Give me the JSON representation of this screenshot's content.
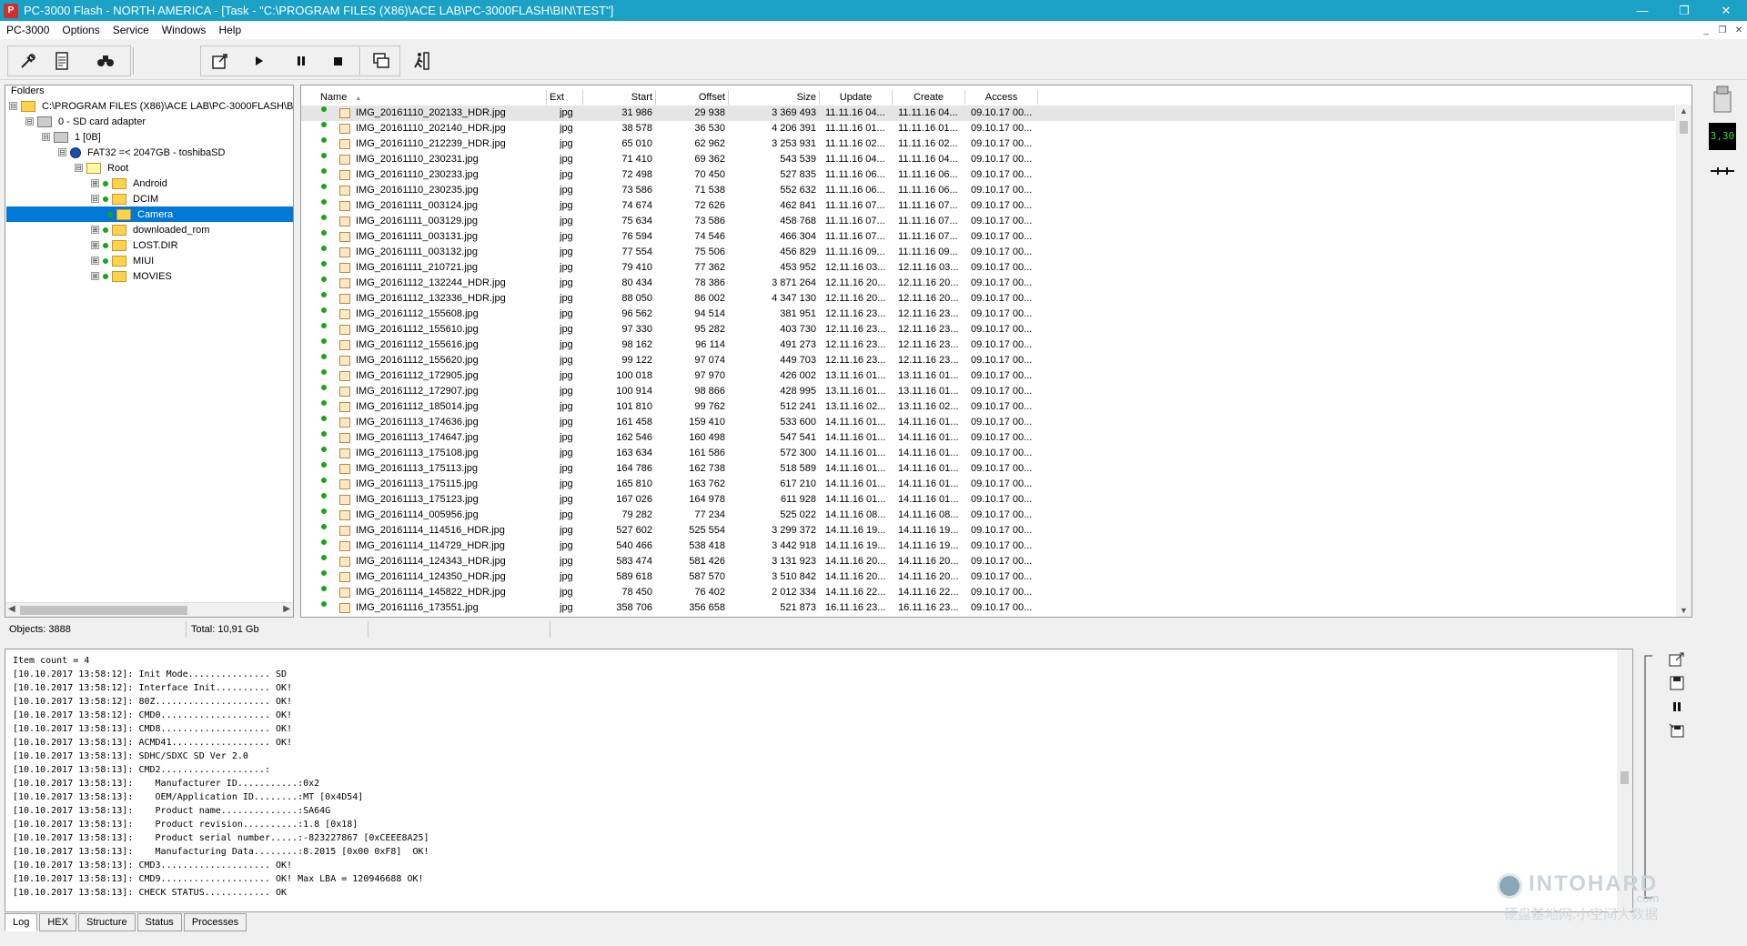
{
  "titlebar": {
    "app_icon": "pc3000-icon",
    "title": "PC-3000 Flash - NORTH AMERICA - [Task - \"C:\\PROGRAM FILES (X86)\\ACE LAB\\PC-3000FLASH\\BIN\\TEST\"]",
    "min": "—",
    "max": "❐",
    "close": "✕"
  },
  "menubar": {
    "items": [
      "PC-3000",
      "Options",
      "Service",
      "Windows",
      "Help"
    ],
    "mdi": [
      "_",
      "❐",
      "✕"
    ]
  },
  "folders": {
    "header": "Folders",
    "tree": [
      {
        "label": "C:\\PROGRAM FILES (X86)\\ACE LAB\\PC-3000FLASH\\B",
        "expander": "⊟"
      },
      {
        "label": "0 - SD card adapter",
        "expander": "⊟"
      },
      {
        "label": "1 [0B]",
        "expander": "⊟"
      },
      {
        "label": "FAT32 =< 2047GB - toshibaSD",
        "expander": "⊟"
      },
      {
        "label": "Root",
        "expander": "⊟"
      },
      {
        "label": "Android",
        "expander": "⊞"
      },
      {
        "label": "DCIM",
        "expander": "⊟"
      },
      {
        "label": "Camera",
        "expander": ""
      },
      {
        "label": "downloaded_rom",
        "expander": "⊞"
      },
      {
        "label": "LOST.DIR",
        "expander": "⊞"
      },
      {
        "label": "MIUI",
        "expander": "⊞"
      },
      {
        "label": "MOVIES",
        "expander": "⊞"
      }
    ]
  },
  "filelist": {
    "columns": [
      "Name",
      "Ext",
      "Start",
      "Offset",
      "Size",
      "Update",
      "Create",
      "Access"
    ],
    "sort_indicator": "▲",
    "rows": [
      [
        "IMG_20161110_202133_HDR.jpg",
        "jpg",
        "31 986",
        "29 938",
        "3 369 493",
        "11.11.16 04...",
        "11.11.16 04...",
        "09.10.17 00..."
      ],
      [
        "IMG_20161110_202140_HDR.jpg",
        "jpg",
        "38 578",
        "36 530",
        "4 206 391",
        "11.11.16 01...",
        "11.11.16 01...",
        "09.10.17 00..."
      ],
      [
        "IMG_20161110_212239_HDR.jpg",
        "jpg",
        "65 010",
        "62 962",
        "3 253 931",
        "11.11.16 02...",
        "11.11.16 02...",
        "09.10.17 00..."
      ],
      [
        "IMG_20161110_230231.jpg",
        "jpg",
        "71 410",
        "69 362",
        "543 539",
        "11.11.16 04...",
        "11.11.16 04...",
        "09.10.17 00..."
      ],
      [
        "IMG_20161110_230233.jpg",
        "jpg",
        "72 498",
        "70 450",
        "527 835",
        "11.11.16 06...",
        "11.11.16 06...",
        "09.10.17 00..."
      ],
      [
        "IMG_20161110_230235.jpg",
        "jpg",
        "73 586",
        "71 538",
        "552 632",
        "11.11.16 06...",
        "11.11.16 06...",
        "09.10.17 00..."
      ],
      [
        "IMG_20161111_003124.jpg",
        "jpg",
        "74 674",
        "72 626",
        "462 841",
        "11.11.16 07...",
        "11.11.16 07...",
        "09.10.17 00..."
      ],
      [
        "IMG_20161111_003129.jpg",
        "jpg",
        "75 634",
        "73 586",
        "458 768",
        "11.11.16 07...",
        "11.11.16 07...",
        "09.10.17 00..."
      ],
      [
        "IMG_20161111_003131.jpg",
        "jpg",
        "76 594",
        "74 546",
        "466 304",
        "11.11.16 07...",
        "11.11.16 07...",
        "09.10.17 00..."
      ],
      [
        "IMG_20161111_003132.jpg",
        "jpg",
        "77 554",
        "75 506",
        "456 829",
        "11.11.16 09...",
        "11.11.16 09...",
        "09.10.17 00..."
      ],
      [
        "IMG_20161111_210721.jpg",
        "jpg",
        "79 410",
        "77 362",
        "453 952",
        "12.11.16 03...",
        "12.11.16 03...",
        "09.10.17 00..."
      ],
      [
        "IMG_20161112_132244_HDR.jpg",
        "jpg",
        "80 434",
        "78 386",
        "3 871 264",
        "12.11.16 20...",
        "12.11.16 20...",
        "09.10.17 00..."
      ],
      [
        "IMG_20161112_132336_HDR.jpg",
        "jpg",
        "88 050",
        "86 002",
        "4 347 130",
        "12.11.16 20...",
        "12.11.16 20...",
        "09.10.17 00..."
      ],
      [
        "IMG_20161112_155608.jpg",
        "jpg",
        "96 562",
        "94 514",
        "381 951",
        "12.11.16 23...",
        "12.11.16 23...",
        "09.10.17 00..."
      ],
      [
        "IMG_20161112_155610.jpg",
        "jpg",
        "97 330",
        "95 282",
        "403 730",
        "12.11.16 23...",
        "12.11.16 23...",
        "09.10.17 00..."
      ],
      [
        "IMG_20161112_155616.jpg",
        "jpg",
        "98 162",
        "96 114",
        "491 273",
        "12.11.16 23...",
        "12.11.16 23...",
        "09.10.17 00..."
      ],
      [
        "IMG_20161112_155620.jpg",
        "jpg",
        "99 122",
        "97 074",
        "449 703",
        "12.11.16 23...",
        "12.11.16 23...",
        "09.10.17 00..."
      ],
      [
        "IMG_20161112_172905.jpg",
        "jpg",
        "100 018",
        "97 970",
        "426 002",
        "13.11.16 01...",
        "13.11.16 01...",
        "09.10.17 00..."
      ],
      [
        "IMG_20161112_172907.jpg",
        "jpg",
        "100 914",
        "98 866",
        "428 995",
        "13.11.16 01...",
        "13.11.16 01...",
        "09.10.17 00..."
      ],
      [
        "IMG_20161112_185014.jpg",
        "jpg",
        "101 810",
        "99 762",
        "512 241",
        "13.11.16 02...",
        "13.11.16 02...",
        "09.10.17 00..."
      ],
      [
        "IMG_20161113_174636.jpg",
        "jpg",
        "161 458",
        "159 410",
        "533 600",
        "14.11.16 01...",
        "14.11.16 01...",
        "09.10.17 00..."
      ],
      [
        "IMG_20161113_174647.jpg",
        "jpg",
        "162 546",
        "160 498",
        "547 541",
        "14.11.16 01...",
        "14.11.16 01...",
        "09.10.17 00..."
      ],
      [
        "IMG_20161113_175108.jpg",
        "jpg",
        "163 634",
        "161 586",
        "572 300",
        "14.11.16 01...",
        "14.11.16 01...",
        "09.10.17 00..."
      ],
      [
        "IMG_20161113_175113.jpg",
        "jpg",
        "164 786",
        "162 738",
        "518 589",
        "14.11.16 01...",
        "14.11.16 01...",
        "09.10.17 00..."
      ],
      [
        "IMG_20161113_175115.jpg",
        "jpg",
        "165 810",
        "163 762",
        "617 210",
        "14.11.16 01...",
        "14.11.16 01...",
        "09.10.17 00..."
      ],
      [
        "IMG_20161113_175123.jpg",
        "jpg",
        "167 026",
        "164 978",
        "611 928",
        "14.11.16 01...",
        "14.11.16 01...",
        "09.10.17 00..."
      ],
      [
        "IMG_20161114_005956.jpg",
        "jpg",
        "79 282",
        "77 234",
        "525 022",
        "14.11.16 08...",
        "14.11.16 08...",
        "09.10.17 00..."
      ],
      [
        "IMG_20161114_114516_HDR.jpg",
        "jpg",
        "527 602",
        "525 554",
        "3 299 372",
        "14.11.16 19...",
        "14.11.16 19...",
        "09.10.17 00..."
      ],
      [
        "IMG_20161114_114729_HDR.jpg",
        "jpg",
        "540 466",
        "538 418",
        "3 442 918",
        "14.11.16 19...",
        "14.11.16 19...",
        "09.10.17 00..."
      ],
      [
        "IMG_20161114_124343_HDR.jpg",
        "jpg",
        "583 474",
        "581 426",
        "3 131 923",
        "14.11.16 20...",
        "14.11.16 20...",
        "09.10.17 00..."
      ],
      [
        "IMG_20161114_124350_HDR.jpg",
        "jpg",
        "589 618",
        "587 570",
        "3 510 842",
        "14.11.16 20...",
        "14.11.16 20...",
        "09.10.17 00..."
      ],
      [
        "IMG_20161114_145822_HDR.jpg",
        "jpg",
        "78 450",
        "76 402",
        "2 012 334",
        "14.11.16 22...",
        "14.11.16 22...",
        "09.10.17 00..."
      ],
      [
        "IMG_20161116_173551.jpg",
        "jpg",
        "358 706",
        "356 658",
        "521 873",
        "16.11.16 23...",
        "16.11.16 23...",
        "09.10.17 00..."
      ]
    ]
  },
  "rightpanel": {
    "lcd": "3,30"
  },
  "statusbar": {
    "objects": "Objects: 3888",
    "total": "Total: 10,91 Gb"
  },
  "log": {
    "lines": [
      "Item count = 4",
      "[10.10.2017 13:58:12]: Init Mode............... SD",
      "[10.10.2017 13:58:12]: Interface Init.......... OK!",
      "[10.10.2017 13:58:12]: 80Z..................... OK!",
      "[10.10.2017 13:58:12]: CMD0.................... OK!",
      "[10.10.2017 13:58:13]: CMD8.................... OK!",
      "[10.10.2017 13:58:13]: ACMD41.................. OK!",
      "[10.10.2017 13:58:13]: SDHC/SDXC SD Ver 2.0",
      "[10.10.2017 13:58:13]: CMD2...................:",
      "[10.10.2017 13:58:13]:    Manufacturer ID...........:0x2",
      "[10.10.2017 13:58:13]:    OEM/Application ID........:MT [0x4D54]",
      "[10.10.2017 13:58:13]:    Product name..............:SA64G",
      "[10.10.2017 13:58:13]:    Product revision..........:1.8 [0x18]",
      "[10.10.2017 13:58:13]:    Product serial number.....:-823227867 [0xCEEE8A25]",
      "[10.10.2017 13:58:13]:    Manufacturing Data........:8.2015 [0x00 0xF8]  OK!",
      "[10.10.2017 13:58:13]: CMD3.................... OK!",
      "[10.10.2017 13:58:13]: CMD9.................... OK! Max LBA = 120946688 OK!",
      "[10.10.2017 13:58:13]: CHECK STATUS............ OK"
    ]
  },
  "tabs": [
    "Log",
    "HEX",
    "Structure",
    "Status",
    "Processes"
  ],
  "watermark": {
    "brand": "INTOHARD",
    "suffix": ".com",
    "tagline": "硬盘基地网.小空间大数据"
  }
}
